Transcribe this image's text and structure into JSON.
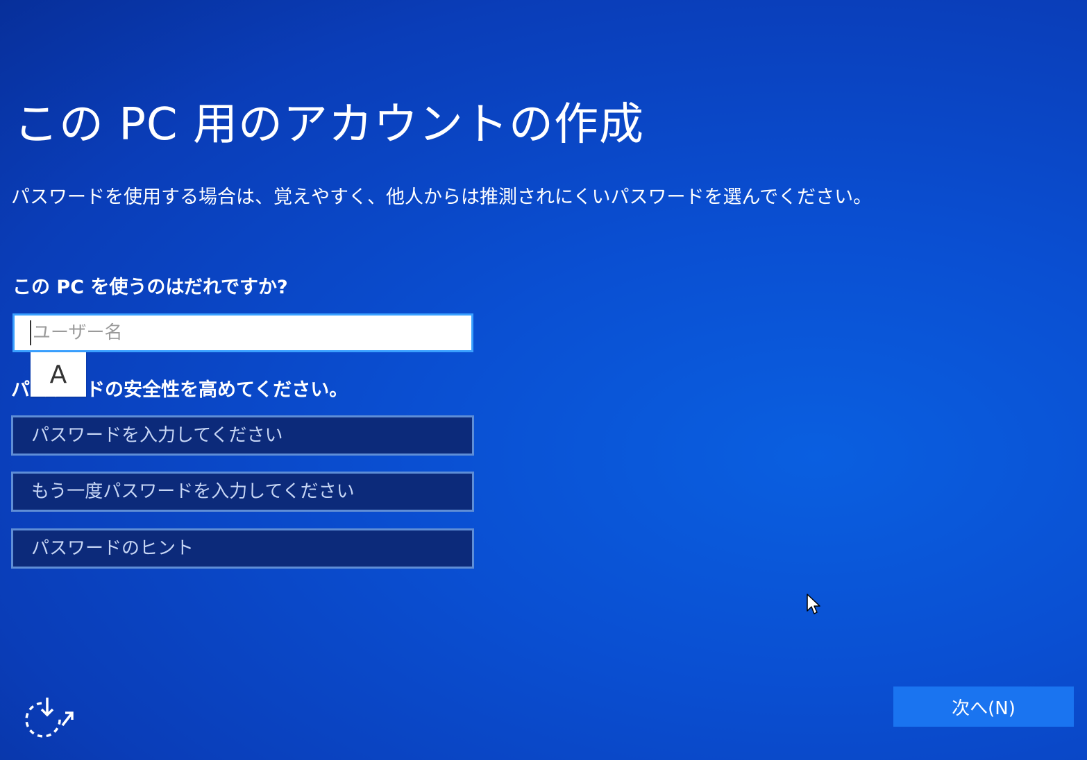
{
  "page": {
    "title": "この PC 用のアカウントの作成",
    "description": "パスワードを使用する場合は、覚えやすく、他人からは推測されにくいパスワードを選んでください。"
  },
  "user": {
    "question": "この PC を使うのはだれですか?",
    "placeholder": "ユーザー名",
    "value": ""
  },
  "ime": {
    "mode": "A"
  },
  "password": {
    "section_label": "パスワードの安全性を高めてください。",
    "field1_placeholder": "パスワードを入力してください",
    "field2_placeholder": "もう一度パスワードを入力してください",
    "hint_placeholder": "パスワードのヒント"
  },
  "footer": {
    "next_label": "次へ(N)"
  },
  "icons": {
    "accessibility": "ease-of-access-icon",
    "pointer": "mouse-cursor-icon"
  },
  "colors": {
    "background": "#0a4fd2",
    "input_focus_border": "#3aa0ff",
    "field_background": "#0c2a7a",
    "next_button": "#1a74f0"
  }
}
